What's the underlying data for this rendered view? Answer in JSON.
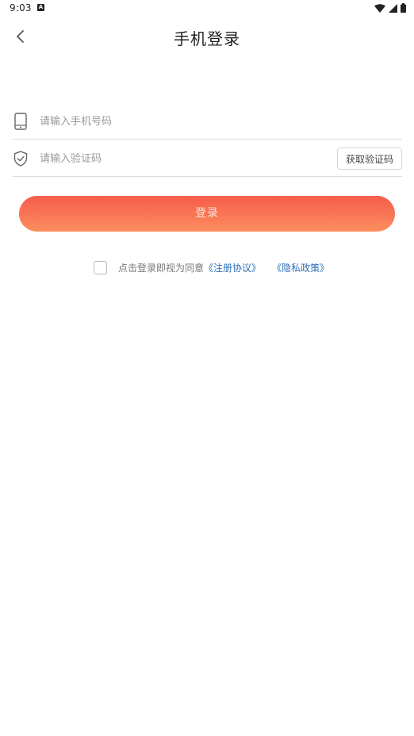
{
  "status_bar": {
    "time": "9:03",
    "notification_badge": "A"
  },
  "header": {
    "title": "手机登录"
  },
  "form": {
    "phone": {
      "value": "",
      "placeholder": "请输入手机号码"
    },
    "code": {
      "value": "",
      "placeholder": "请输入验证码",
      "get_code_label": "获取验证码"
    }
  },
  "login_button": {
    "label": "登录"
  },
  "agreement": {
    "checked": false,
    "prefix_text": "点击登录即视为同意",
    "register_link": "《注册协议》",
    "privacy_link": "《隐私政策》"
  },
  "colors": {
    "accent_gradient_top": "#f65c4b",
    "accent_gradient_bottom": "#fb8e5e",
    "link": "#2f6eb8"
  },
  "icons": [
    "chevron-left-icon",
    "phone-icon",
    "shield-check-icon",
    "wifi-icon",
    "signal-icon",
    "battery-icon"
  ]
}
